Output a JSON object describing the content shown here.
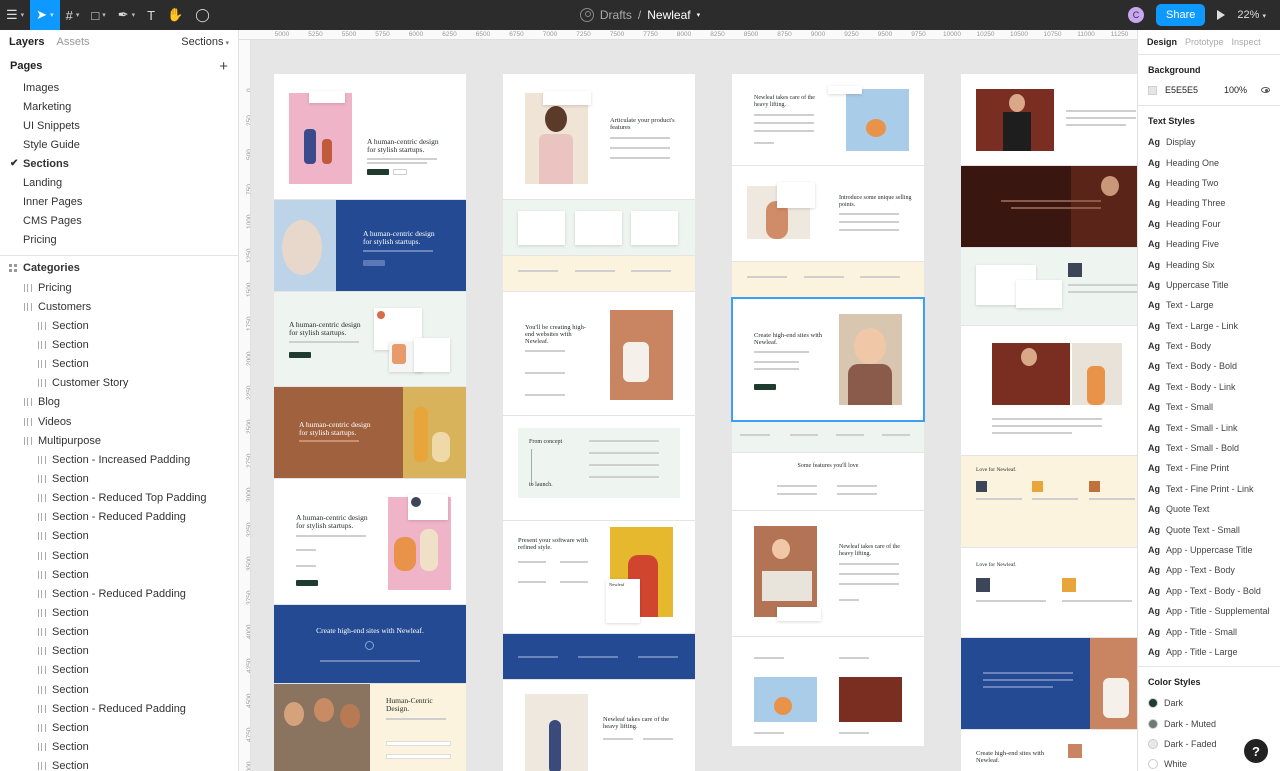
{
  "toolbar": {
    "breadcrumb_team": "Drafts",
    "breadcrumb_sep": "/",
    "file_name": "Newleaf",
    "avatar_letter": "C",
    "share_label": "Share",
    "zoom": "22%"
  },
  "left_panel": {
    "tab_layers": "Layers",
    "tab_assets": "Assets",
    "page_selector": "Sections",
    "pages_title": "Pages",
    "pages": [
      "Images",
      "Marketing",
      "UI Snippets",
      "Style Guide",
      "Sections",
      "Landing",
      "Inner Pages",
      "CMS Pages",
      "Pricing"
    ],
    "current_page": "Sections",
    "layers": [
      {
        "label": "Categories",
        "level": 0,
        "icon": "grid"
      },
      {
        "label": "Pricing",
        "level": 1,
        "icon": "frame"
      },
      {
        "label": "Customers",
        "level": 1,
        "icon": "frame"
      },
      {
        "label": "Section",
        "level": 2,
        "icon": "frame"
      },
      {
        "label": "Section",
        "level": 2,
        "icon": "frame"
      },
      {
        "label": "Section",
        "level": 2,
        "icon": "frame"
      },
      {
        "label": "Customer Story",
        "level": 2,
        "icon": "frame"
      },
      {
        "label": "Blog",
        "level": 1,
        "icon": "frame"
      },
      {
        "label": "Videos",
        "level": 1,
        "icon": "frame"
      },
      {
        "label": "Multipurpose",
        "level": 1,
        "icon": "frame"
      },
      {
        "label": "Section - Increased Padding",
        "level": 2,
        "icon": "frame"
      },
      {
        "label": "Section",
        "level": 2,
        "icon": "frame"
      },
      {
        "label": "Section - Reduced Top Padding",
        "level": 2,
        "icon": "frame"
      },
      {
        "label": "Section - Reduced Padding",
        "level": 2,
        "icon": "frame"
      },
      {
        "label": "Section",
        "level": 2,
        "icon": "frame"
      },
      {
        "label": "Section",
        "level": 2,
        "icon": "frame"
      },
      {
        "label": "Section",
        "level": 2,
        "icon": "frame"
      },
      {
        "label": "Section - Reduced Padding",
        "level": 2,
        "icon": "frame"
      },
      {
        "label": "Section",
        "level": 2,
        "icon": "frame"
      },
      {
        "label": "Section",
        "level": 2,
        "icon": "frame"
      },
      {
        "label": "Section",
        "level": 2,
        "icon": "frame"
      },
      {
        "label": "Section",
        "level": 2,
        "icon": "frame"
      },
      {
        "label": "Section",
        "level": 2,
        "icon": "frame"
      },
      {
        "label": "Section - Reduced Padding",
        "level": 2,
        "icon": "frame"
      },
      {
        "label": "Section",
        "level": 2,
        "icon": "frame"
      },
      {
        "label": "Section",
        "level": 2,
        "icon": "frame"
      },
      {
        "label": "Section",
        "level": 2,
        "icon": "frame"
      }
    ]
  },
  "ruler_top": [
    "5000",
    "5250",
    "5500",
    "5750",
    "6000",
    "6250",
    "6500",
    "6750",
    "7000",
    "7250",
    "7500",
    "7750",
    "8000",
    "8250",
    "8500",
    "8750",
    "9000",
    "9250",
    "9500",
    "9750",
    "10000",
    "10250",
    "10500",
    "10750",
    "11000",
    "11250"
  ],
  "ruler_left": [
    "0",
    "250",
    "500",
    "750",
    "1000",
    "1250",
    "1500",
    "1750",
    "2000",
    "2250",
    "2500",
    "2750",
    "3000",
    "3250",
    "3500",
    "3750",
    "4000",
    "4250",
    "4500",
    "4750",
    "5000"
  ],
  "canvas": {
    "headings": {
      "c1_t1": "A human-centric design for stylish startups.",
      "c1_t2": "A human-centric design for stylish startups.",
      "c1_t3": "A human-centric design for stylish startups.",
      "c1_t4": "A human-centric design for stylish startups.",
      "c1_t5": "A human-centric design for stylish startups.",
      "c1_t6": "Create high-end sites with Newleaf.",
      "c1_t7": "Human-Centric Design.",
      "c2_t1": "Articulate your product's features",
      "c2_t4": "You'll be creating high-end websites with Newleaf.",
      "c2_t5a": "From concept",
      "c2_t5b": "to launch.",
      "c2_t6": "Present your software with refined style.",
      "c2_t6_card": "Newleaf",
      "c2_t8": "Newleaf takes care of the heavy lifting.",
      "c3_t1": "Newleaf takes care of the heavy lifting.",
      "c3_t2": "Introduce some unique selling points.",
      "c3_t4": "Create high-end sites with Newleaf.",
      "c3_t6": "Some features you'll love",
      "c3_t7": "Newleaf takes care of the heavy lifting.",
      "c4_t6": "Love for Newleaf.",
      "c4_t7": "Love for Newleaf.",
      "c4_t9": "Create high-end sites with Newleaf."
    }
  },
  "right_panel": {
    "tab_design": "Design",
    "tab_prototype": "Prototype",
    "tab_inspect": "Inspect",
    "background_title": "Background",
    "background_hex": "E5E5E5",
    "background_opacity": "100%",
    "text_styles_title": "Text Styles",
    "text_style_icon": "Ag",
    "text_styles": [
      "Display",
      "Heading One",
      "Heading Two",
      "Heading Three",
      "Heading Four",
      "Heading Five",
      "Heading Six",
      "Uppercase Title",
      "Text - Large",
      "Text - Large - Link",
      "Text - Body",
      "Text - Body - Bold",
      "Text - Body - Link",
      "Text - Small",
      "Text - Small - Link",
      "Text - Small - Bold",
      "Text - Fine Print",
      "Text - Fine Print - Link",
      "Quote Text",
      "Quote Text - Small",
      "App - Uppercase Title",
      "App - Text - Body",
      "App - Text - Body - Bold",
      "App - Title - Supplemental",
      "App - Title - Small",
      "App - Title - Large"
    ],
    "color_styles_title": "Color Styles",
    "color_styles": [
      {
        "label": "Dark",
        "color": "#1f3a2e"
      },
      {
        "label": "Dark - Muted",
        "color": "#6b7a72"
      },
      {
        "label": "Dark - Faded",
        "color": "#e8e8e8"
      },
      {
        "label": "White",
        "color": "#ffffff"
      }
    ]
  },
  "help_label": "?"
}
